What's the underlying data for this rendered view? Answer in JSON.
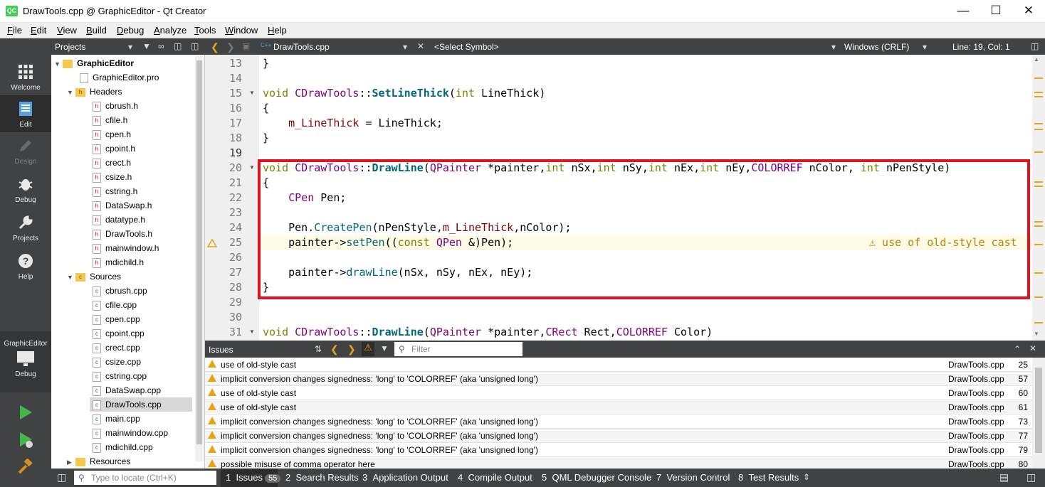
{
  "window": {
    "title": "DrawTools.cpp @ GraphicEditor - Qt Creator",
    "app_icon": "QC"
  },
  "menu": [
    "File",
    "Edit",
    "View",
    "Build",
    "Debug",
    "Analyze",
    "Tools",
    "Window",
    "Help"
  ],
  "modes": [
    {
      "label": "Welcome",
      "icon": "grid-icon"
    },
    {
      "label": "Edit",
      "icon": "document-icon",
      "active": true
    },
    {
      "label": "Design",
      "icon": "pencil-icon",
      "disabled": true
    },
    {
      "label": "Debug",
      "icon": "bug-icon"
    },
    {
      "label": "Projects",
      "icon": "wrench-icon"
    },
    {
      "label": "Help",
      "icon": "question-icon"
    }
  ],
  "kit": {
    "project": "GraphicEditor",
    "config": "Debug"
  },
  "projects_pane": {
    "title": "Projects"
  },
  "tree": {
    "root": "GraphicEditor",
    "pro": "GraphicEditor.pro",
    "headers_label": "Headers",
    "headers": [
      "cbrush.h",
      "cfile.h",
      "cpen.h",
      "cpoint.h",
      "crect.h",
      "csize.h",
      "cstring.h",
      "DataSwap.h",
      "datatype.h",
      "DrawTools.h",
      "mainwindow.h",
      "mdichild.h"
    ],
    "sources_label": "Sources",
    "sources": [
      "cbrush.cpp",
      "cfile.cpp",
      "cpen.cpp",
      "cpoint.cpp",
      "crect.cpp",
      "csize.cpp",
      "cstring.cpp",
      "DataSwap.cpp",
      "DrawTools.cpp",
      "main.cpp",
      "mainwindow.cpp",
      "mdichild.cpp"
    ],
    "resources_label": "Resources",
    "selected": "DrawTools.cpp"
  },
  "editor_toolbar": {
    "file": "DrawTools.cpp",
    "symbol": "<Select Symbol>",
    "line_ending": "Windows (CRLF)",
    "position": "Line: 19, Col: 1"
  },
  "code_lines": [
    "13",
    "14",
    "15",
    "16",
    "17",
    "18",
    "19",
    "20",
    "21",
    "22",
    "23",
    "24",
    "25",
    "26",
    "27",
    "28",
    "29",
    "30",
    "31"
  ],
  "code": {
    "l13": "}",
    "l15_void": "void ",
    "l15_cls": "CDrawTools",
    "l15_sep": "::",
    "l15_fn": "SetLineThick",
    "l15_a": "(",
    "l15_int": "int",
    "l15_b": " LineThick)",
    "l16": "{",
    "l17_mem": "m_LineThick",
    "l17_rest": " = LineThick;",
    "l18": "}",
    "l20_void": "void ",
    "l20_cls": "CDrawTools",
    "l20_sep": "::",
    "l20_fn": "DrawLine",
    "l20_a": "(",
    "l20_qp": "QPainter",
    "l20_b": " *painter,",
    "l20_i1": "int",
    "l20_c": " nSx,",
    "l20_i2": "int",
    "l20_d": " nSy,",
    "l20_i3": "int",
    "l20_e": " nEx,",
    "l20_i4": "int",
    "l20_f": " nEy,",
    "l20_cr": "COLORREF",
    "l20_g": " nColor, ",
    "l20_i5": "int",
    "l20_h": " nPenStyle)",
    "l21": "{",
    "l22_ty": "CPen",
    "l22_rest": " Pen;",
    "l24_a": "Pen.",
    "l24_fn": "CreatePen",
    "l24_b": "(nPenStyle,",
    "l24_mem": "m_LineThick",
    "l24_c": ",nColor);",
    "l25_a": "painter->",
    "l25_fn": "setPen",
    "l25_b": "((",
    "l25_kw": "const",
    "l25_sp": " ",
    "l25_ty": "QPen",
    "l25_c": " &)Pen);",
    "l25_warn": "⚠ use of old-style cast",
    "l27_a": "painter->",
    "l27_fn": "drawLine",
    "l27_b": "(nSx, nSy, nEx, nEy);",
    "l28": "}",
    "l31_void": "void ",
    "l31_cls": "CDrawTools",
    "l31_sep": "::",
    "l31_fn": "DrawLine",
    "l31_a": "(",
    "l31_qp": "QPainter",
    "l31_b": " *painter,",
    "l31_cr": "CRect",
    "l31_c": " Rect,",
    "l31_col": "COLORREF",
    "l31_d": " Color)"
  },
  "issues_pane": {
    "title": "Issues",
    "filter_placeholder": "Filter"
  },
  "issues": [
    {
      "text": "use of old-style cast",
      "file": "DrawTools.cpp",
      "line": "25"
    },
    {
      "text": "implicit conversion changes signedness: 'long' to 'COLORREF' (aka 'unsigned long')",
      "file": "DrawTools.cpp",
      "line": "57"
    },
    {
      "text": "use of old-style cast",
      "file": "DrawTools.cpp",
      "line": "60"
    },
    {
      "text": "use of old-style cast",
      "file": "DrawTools.cpp",
      "line": "61"
    },
    {
      "text": "implicit conversion changes signedness: 'long' to 'COLORREF' (aka 'unsigned long')",
      "file": "DrawTools.cpp",
      "line": "73"
    },
    {
      "text": "implicit conversion changes signedness: 'long' to 'COLORREF' (aka 'unsigned long')",
      "file": "DrawTools.cpp",
      "line": "77"
    },
    {
      "text": "implicit conversion changes signedness: 'long' to 'COLORREF' (aka 'unsigned long')",
      "file": "DrawTools.cpp",
      "line": "79"
    },
    {
      "text": "possible misuse of comma operator here",
      "file": "DrawTools.cpp",
      "line": "80"
    }
  ],
  "bottom": {
    "locate_placeholder": "Type to locate (Ctrl+K)",
    "tabs": [
      {
        "num": "1",
        "label": "Issues",
        "badge": "55"
      },
      {
        "num": "2",
        "label": "Search Results"
      },
      {
        "num": "3",
        "label": "Application Output"
      },
      {
        "num": "4",
        "label": "Compile Output"
      },
      {
        "num": "5",
        "label": "QML Debugger Console"
      },
      {
        "num": "7",
        "label": "Version Control"
      },
      {
        "num": "8",
        "label": "Test Results"
      }
    ]
  },
  "colors": {
    "highlight_box": "#e0141e",
    "warning": "#e8a317",
    "sidebar": "#404244"
  }
}
